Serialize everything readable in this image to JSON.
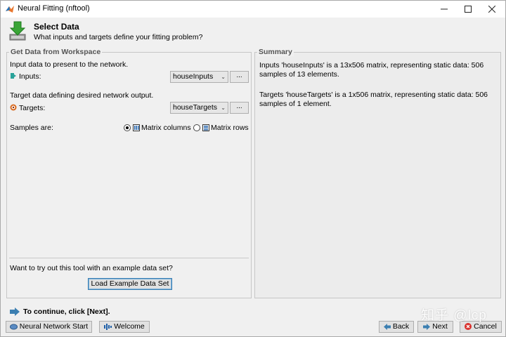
{
  "window": {
    "title": "Neural Fitting (nftool)"
  },
  "header": {
    "title": "Select Data",
    "subtitle": "What inputs and targets define your fitting problem?"
  },
  "left_panel": {
    "title": "Get Data from Workspace",
    "inputs_prompt": "Input data to present to the network.",
    "inputs_label": "Inputs:",
    "inputs_value": "houseInputs",
    "targets_prompt": "Target data defining desired network output.",
    "targets_label": "Targets:",
    "targets_value": "houseTargets",
    "browse_label": "...",
    "samples_label": "Samples are:",
    "option_columns": "Matrix columns",
    "option_rows": "Matrix rows",
    "selected_option": "Matrix columns",
    "example_prompt": "Want to try out this tool with an example data set?",
    "load_example_label": "Load Example Data Set"
  },
  "summary": {
    "title": "Summary",
    "inputs_text": "Inputs 'houseInputs' is a 13x506 matrix, representing static data: 506 samples of 13 elements.",
    "targets_text": "Targets 'houseTargets' is a 1x506 matrix, representing static data: 506 samples of 1 element."
  },
  "footer": {
    "continue_text": "To continue, click [Next].",
    "nn_start_label": "Neural Network Start",
    "welcome_label": "Welcome",
    "back_label": "Back",
    "next_label": "Next",
    "cancel_label": "Cancel"
  },
  "watermark": "知乎 @lcp",
  "colors": {
    "accent_blue": "#3c7fb1",
    "cancel_red": "#d9302c",
    "green_arrow": "#3aa537",
    "input_teal": "#2aa39a",
    "target_orange": "#d86a1f"
  },
  "icons": [
    "matlab-icon",
    "download-arrow-icon",
    "input-icon",
    "target-icon",
    "matrix-columns-icon",
    "matrix-rows-icon",
    "info-arrow-icon",
    "nn-start-icon",
    "welcome-icon",
    "back-arrow-icon",
    "next-arrow-icon",
    "cancel-icon"
  ]
}
